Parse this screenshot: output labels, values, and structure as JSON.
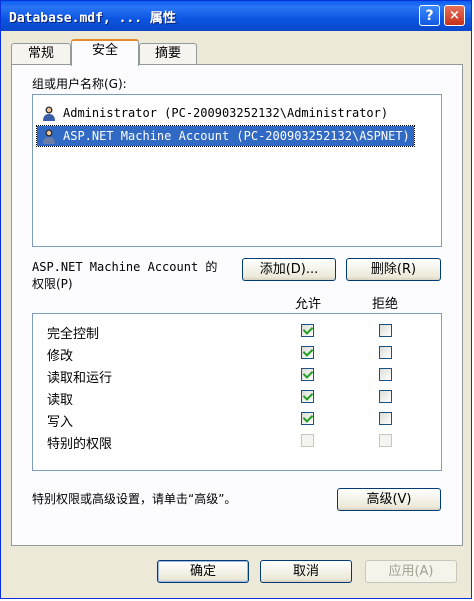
{
  "window": {
    "title": "Database.mdf, ... 属性",
    "help_label": "?",
    "close_label": "×"
  },
  "tabs": [
    {
      "label": "常规",
      "active": false
    },
    {
      "label": "安全",
      "active": true
    },
    {
      "label": "摘要",
      "active": false
    }
  ],
  "users": {
    "label": "组或用户名称(G):",
    "items": [
      {
        "name": "Administrator (PC-200903252132\\Administrator)",
        "selected": false
      },
      {
        "name": "ASP.NET Machine Account (PC-200903252132\\ASPNET)",
        "selected": true
      }
    ]
  },
  "buttons": {
    "add": "添加(D)...",
    "remove": "删除(R)",
    "advanced": "高级(V)",
    "ok": "确定",
    "cancel": "取消",
    "apply": "应用(A)"
  },
  "permissions": {
    "label_line1": "ASP.NET Machine Account 的",
    "label_line2": "权限(P)",
    "col_allow": "允许",
    "col_deny": "拒绝",
    "rows": [
      {
        "name": "完全控制",
        "allow": true,
        "deny": false,
        "enabled": true
      },
      {
        "name": "修改",
        "allow": true,
        "deny": false,
        "enabled": true
      },
      {
        "name": "读取和运行",
        "allow": true,
        "deny": false,
        "enabled": true
      },
      {
        "name": "读取",
        "allow": true,
        "deny": false,
        "enabled": true
      },
      {
        "name": "写入",
        "allow": true,
        "deny": false,
        "enabled": true
      },
      {
        "name": "特别的权限",
        "allow": false,
        "deny": false,
        "enabled": false
      }
    ]
  },
  "advanced_hint": "特别权限或高级设置，请单击“高级”。",
  "colors": {
    "titlebar": "#0a5fef",
    "selection": "#316ac5",
    "dialog_bg": "#ece9d8",
    "check": "#21a121"
  }
}
